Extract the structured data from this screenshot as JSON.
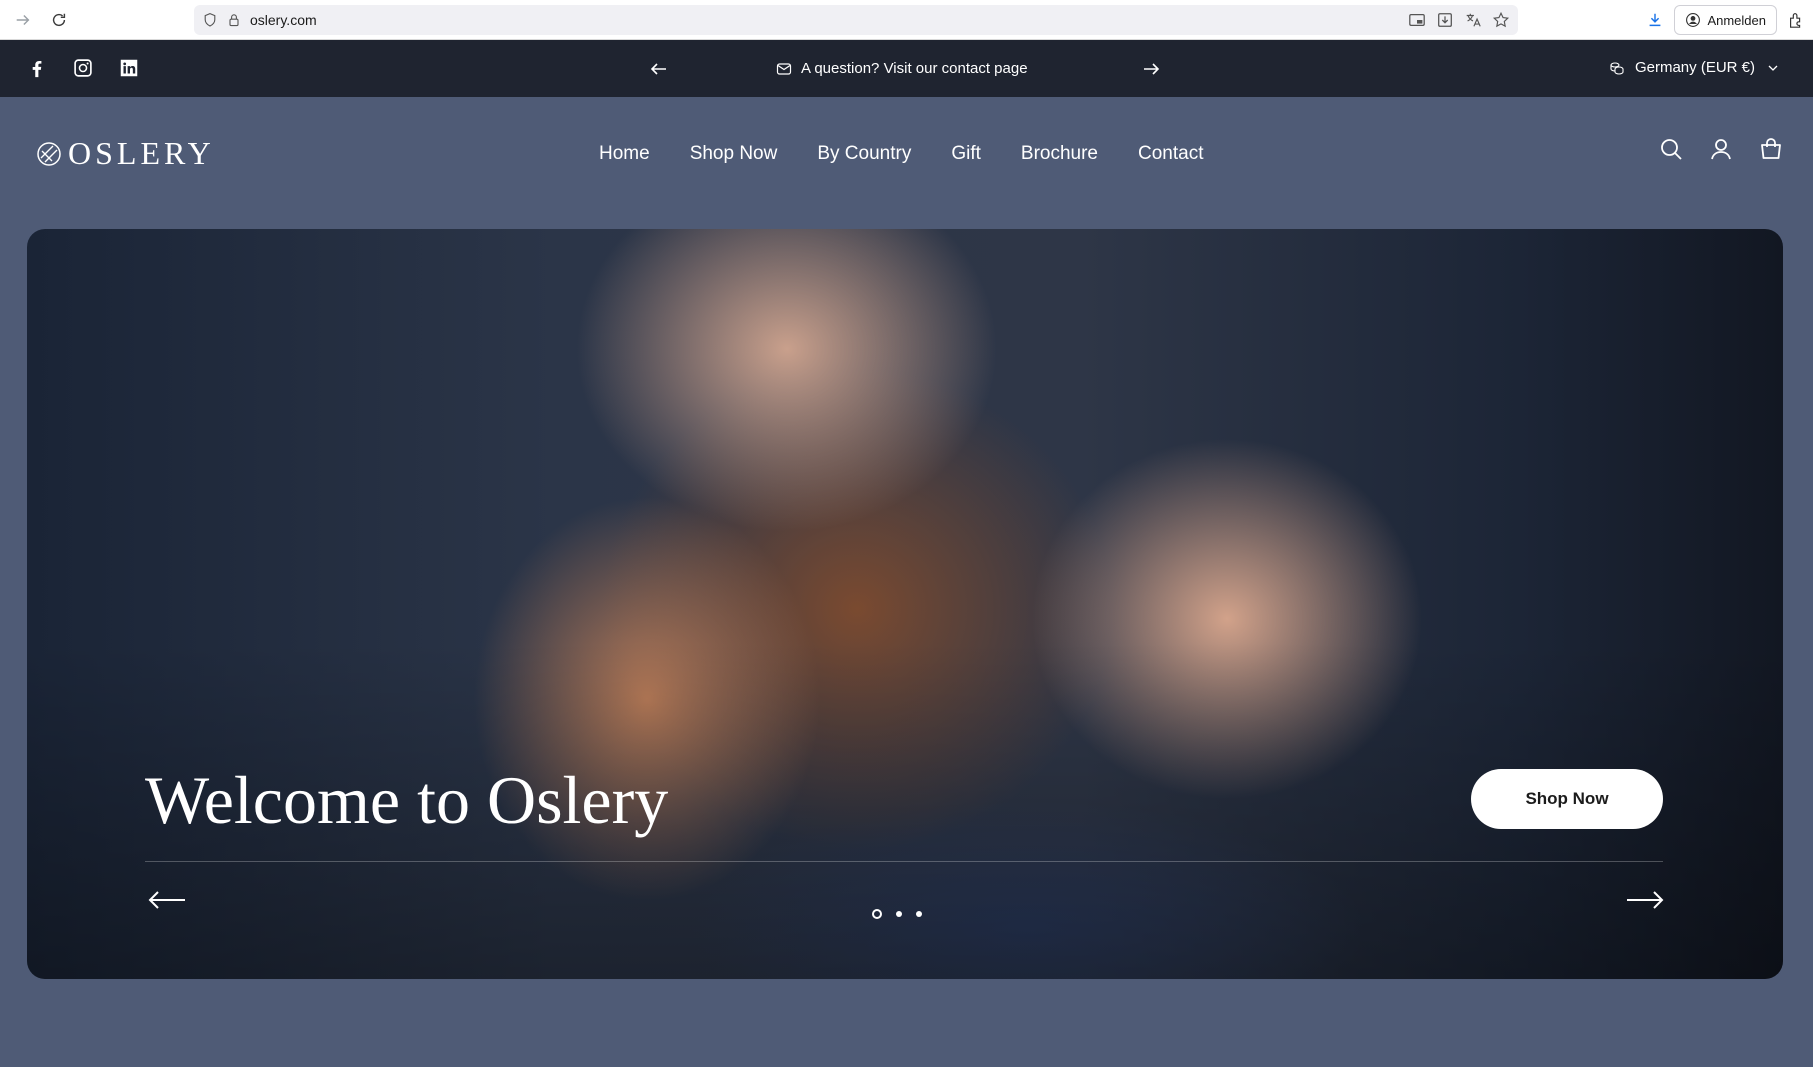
{
  "browser": {
    "url": "oslery.com",
    "signin_label": "Anmelden"
  },
  "announcement": {
    "message": "A question? Visit our contact page",
    "country_selector": "Germany (EUR €)"
  },
  "header": {
    "logo_text": "OSLERY",
    "nav": [
      "Home",
      "Shop Now",
      "By Country",
      "Gift",
      "Brochure",
      "Contact"
    ]
  },
  "hero": {
    "title": "Welcome to Oslery",
    "cta_label": "Shop Now",
    "slide_count": 3,
    "active_slide": 1
  },
  "colors": {
    "page_bg": "#4f5b76",
    "announcement_bg": "#1f2430",
    "cta_bg": "#ffffff"
  }
}
